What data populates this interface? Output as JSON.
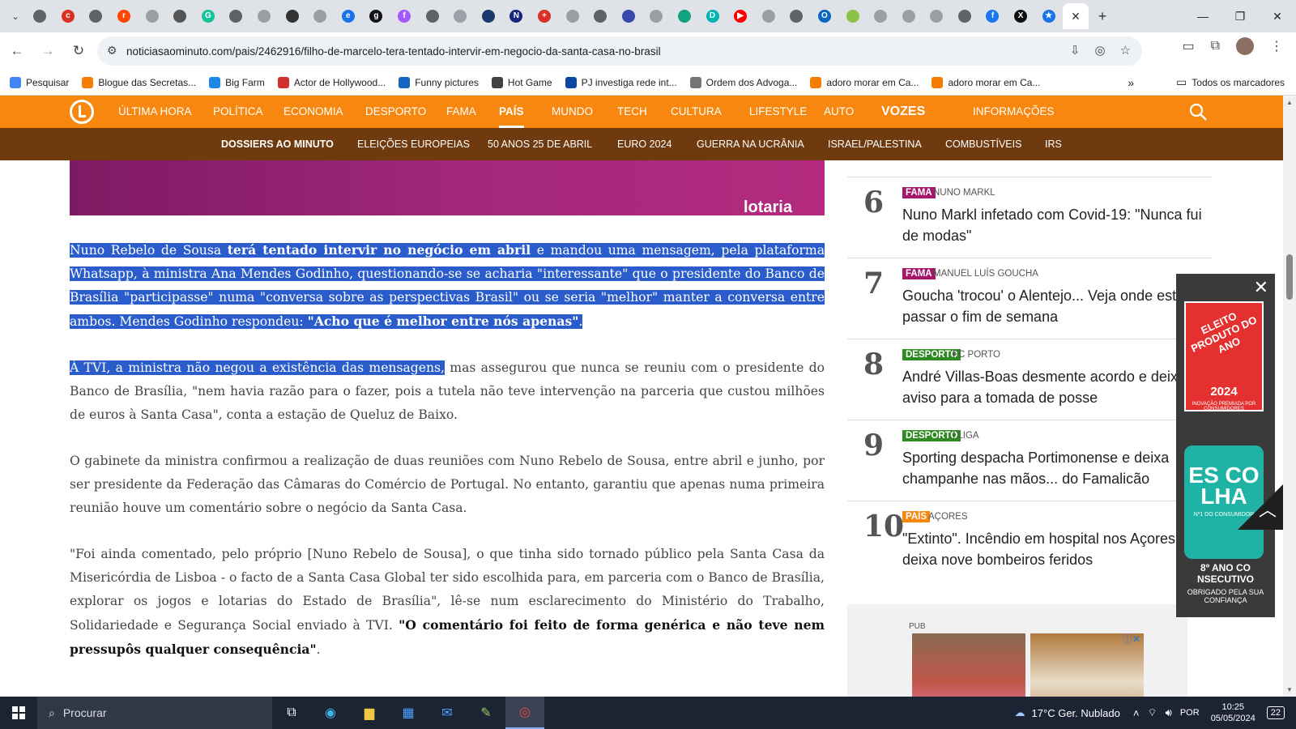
{
  "browser": {
    "url": "noticiasaominuto.com/pais/2462916/filho-de-marcelo-tera-tentado-intervir-em-negocio-da-santa-casa-no-brasil",
    "active_tab_close": "✕",
    "new_tab": "+",
    "favicons": [
      {
        "icon": "globe-icon",
        "color": "#5f6368",
        "glyph": ""
      },
      {
        "icon": "cm-icon",
        "color": "#d93025",
        "glyph": "c"
      },
      {
        "icon": "globe-icon",
        "color": "#5f6368",
        "glyph": ""
      },
      {
        "icon": "reddit-icon",
        "color": "#ff4500",
        "glyph": "r"
      },
      {
        "icon": "globe-icon",
        "color": "#9aa0a6",
        "glyph": ""
      },
      {
        "icon": "feather-icon",
        "color": "#555",
        "glyph": ""
      },
      {
        "icon": "grammarly-icon",
        "color": "#15c39a",
        "glyph": "G"
      },
      {
        "icon": "globe-icon",
        "color": "#5f6368",
        "glyph": ""
      },
      {
        "icon": "globe-icon",
        "color": "#9aa0a6",
        "glyph": ""
      },
      {
        "icon": "card-icon",
        "color": "#333",
        "glyph": ""
      },
      {
        "icon": "globe-icon",
        "color": "#9aa0a6",
        "glyph": ""
      },
      {
        "icon": "edge-icon",
        "color": "#1a73e8",
        "glyph": "e"
      },
      {
        "icon": "github-icon",
        "color": "#111",
        "glyph": "g"
      },
      {
        "icon": "figma-icon",
        "color": "#a259ff",
        "glyph": "f"
      },
      {
        "icon": "globe-icon",
        "color": "#5f6368",
        "glyph": ""
      },
      {
        "icon": "globe-icon",
        "color": "#9aa0a6",
        "glyph": ""
      },
      {
        "icon": "user-icon",
        "color": "#1a3a6b",
        "glyph": ""
      },
      {
        "icon": "n-icon",
        "color": "#1a237e",
        "glyph": "N"
      },
      {
        "icon": "cross-icon",
        "color": "#d93025",
        "glyph": "+"
      },
      {
        "icon": "globe-icon",
        "color": "#9aa0a6",
        "glyph": ""
      },
      {
        "icon": "globe-icon",
        "color": "#5f6368",
        "glyph": ""
      },
      {
        "icon": "spiral-icon",
        "color": "#3949ab",
        "glyph": ""
      },
      {
        "icon": "globe-icon",
        "color": "#9aa0a6",
        "glyph": ""
      },
      {
        "icon": "chatgpt-icon",
        "color": "#10a37f",
        "glyph": ""
      },
      {
        "icon": "d-icon",
        "color": "#00b4b4",
        "glyph": "D"
      },
      {
        "icon": "youtube-icon",
        "color": "#ff0000",
        "glyph": "▶"
      },
      {
        "icon": "globe-icon",
        "color": "#9aa0a6",
        "glyph": ""
      },
      {
        "icon": "globe-icon",
        "color": "#5f6368",
        "glyph": ""
      },
      {
        "icon": "outlook-icon",
        "color": "#0a66c2",
        "glyph": "O"
      },
      {
        "icon": "globe-icon",
        "color": "#8bc34a",
        "glyph": ""
      },
      {
        "icon": "globe-icon",
        "color": "#9aa0a6",
        "glyph": ""
      },
      {
        "icon": "globe-icon",
        "color": "#9aa0a6",
        "glyph": ""
      },
      {
        "icon": "globe-icon",
        "color": "#9aa0a6",
        "glyph": ""
      },
      {
        "icon": "globe-icon",
        "color": "#5f6368",
        "glyph": ""
      },
      {
        "icon": "facebook-icon",
        "color": "#1877f2",
        "glyph": "f"
      },
      {
        "icon": "x-icon",
        "color": "#111",
        "glyph": "X"
      },
      {
        "icon": "star-icon",
        "color": "#1a73e8",
        "glyph": "★"
      }
    ]
  },
  "bookmarks": [
    {
      "label": "Pesquisar",
      "color": "#4285f4"
    },
    {
      "label": "Blogue das Secretas...",
      "color": "#f57c00"
    },
    {
      "label": "Big Farm",
      "color": "#1e88e5"
    },
    {
      "label": "Actor de Hollywood...",
      "color": "#d32f2f"
    },
    {
      "label": "Funny pictures",
      "color": "#1565c0"
    },
    {
      "label": "Hot Game",
      "color": "#424242"
    },
    {
      "label": "PJ investiga rede int...",
      "color": "#0d47a1"
    },
    {
      "label": "Ordem dos Advoga...",
      "color": "#757575"
    },
    {
      "label": "adoro morar em Ca...",
      "color": "#f57c00"
    },
    {
      "label": "adoro morar em Ca...",
      "color": "#f57c00"
    }
  ],
  "bookmarks_more": "»",
  "bookmarks_all": "Todos os marcadores",
  "site": {
    "main_nav": [
      "ÚLTIMA HORA",
      "POLÍTICA",
      "ECONOMIA",
      "DESPORTO",
      "FAMA",
      "PAÍS",
      "MUNDO",
      "TECH",
      "CULTURA",
      "LIFESTYLE",
      "AUTO",
      "VOZES",
      "INFORMAÇÕES"
    ],
    "main_nav_active": "PAÍS",
    "sub_nav": [
      "DOSSIERS AO MINUTO",
      "ELEIÇÕES EUROPEIAS",
      "50 ANOS 25 DE ABRIL",
      "EURO 2024",
      "GUERRA NA UCRÂNIA",
      "ISRAEL/PALESTINA",
      "COMBUSTÍVEIS",
      "IRS"
    ],
    "colors": {
      "orange": "#f7870f",
      "brown": "#6e3a0e",
      "selection": "#2a5ccb"
    }
  },
  "banner_text": "lotaria",
  "article": {
    "p1": {
      "t1": "Nuno Rebelo de Sousa ",
      "b1": "terá tentado intervir no negócio em abril",
      "t2": " e mandou uma mensagem, pela plataforma Whatsapp, à ministra Ana Mendes Godinho, questionando-se se acharia \"interessante\" que o presidente do Banco de Brasília \"participasse\" numa \"conversa sobre as perspectivas Brasil\" ou se seria \"melhor\" manter a conversa entre ambos. Mendes Godinho respondeu: ",
      "b2": "\"Acho que é melhor entre nós apenas\"",
      "t3": "."
    },
    "p2": {
      "sel": "À TVI, a ministra não negou a existência das mensagens,",
      "rest": " mas assegurou que nunca se reuniu com o presidente do Banco de Brasília, \"nem havia razão para o fazer, pois a tutela não teve intervenção na parceria que custou milhões de euros à Santa Casa\", conta a estação de Queluz de Baixo."
    },
    "p3": "O gabinete da ministra confirmou a realização de duas reuniões com Nuno Rebelo de Sousa, entre abril e junho, por ser presidente da Federação das Câmaras do Comércio de Portugal. No entanto, garantiu que apenas numa primeira reunião houve um comentário sobre o negócio da Santa Casa.",
    "p4": {
      "t1": "\"Foi ainda comentado, pelo próprio [Nuno Rebelo de Sousa], o que tinha sido tornado público pela Santa Casa da Misericórdia de Lisboa - o facto de a Santa Casa Global ter sido escolhida para, em parceria com o Banco de Brasília, explorar os jogos e lotarias do Estado de Brasília\", lê-se num esclarecimento do Ministério do Trabalho, Solidariedade e Segurança Social enviado à TVI. ",
      "b1": "\"O comentário foi feito de forma genérica e não teve nem pressupôs qualquer consequência\"",
      "t2": "."
    }
  },
  "rankings": [
    {
      "num": "6",
      "cat": "FAMA",
      "cat_class": "c-fama",
      "tag": "NUNO MARKL",
      "title": "Nuno Markl infetado com Covid-19: \"Nunca fui de modas\""
    },
    {
      "num": "7",
      "cat": "FAMA",
      "cat_class": "c-fama",
      "tag": "MANUEL LUÍS GOUCHA",
      "title": "Goucha 'trocou' o Alentejo... Veja onde está a passar o fim de semana"
    },
    {
      "num": "8",
      "cat": "DESPORTO",
      "cat_class": "c-desporto",
      "tag": "FC PORTO",
      "title": "André Villas-Boas desmente acordo e deixa aviso para a tomada de posse"
    },
    {
      "num": "9",
      "cat": "DESPORTO",
      "cat_class": "c-desporto",
      "tag": "I LIGA",
      "title": "Sporting despacha Portimonense e deixa champanhe nas mãos... do Famalicão"
    },
    {
      "num": "10",
      "cat": "PAÍS",
      "cat_class": "c-pais",
      "tag": "AÇORES",
      "title": "\"Extinto\". Incêndio em hospital nos Açores deixa nove bombeiros feridos"
    }
  ],
  "pub": {
    "label": "PUB"
  },
  "side_ad": {
    "badge1_line1": "ELEITO PRODUTO DO ANO",
    "badge1_year": "2024",
    "badge1_small": "INOVAÇÃO PREMIADA POR CONSUMIDORES",
    "badge2_big": "ES CO LHA",
    "badge2_small": "Nº1 DO CONSUMIDOR",
    "foot1": "8º ANO CO NSECUTIVO",
    "foot2": "OBRIGADO PELA SUA CONFIANÇA"
  },
  "taskbar": {
    "search": "Procurar",
    "weather": "17°C  Ger. Nublado",
    "lang": "POR",
    "time": "10:25",
    "date": "05/05/2024",
    "notif": "22"
  }
}
